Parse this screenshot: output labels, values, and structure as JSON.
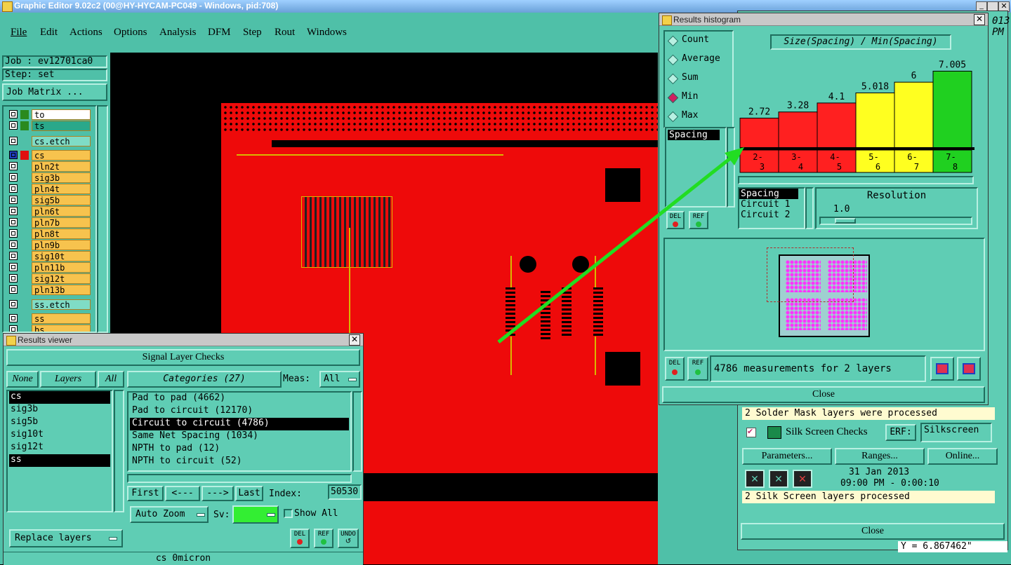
{
  "app": {
    "title": "Graphic Editor 9.02c2 (00@HY-HYCAM-PC049 - Windows, pid:708)",
    "menu": [
      "File",
      "Edit",
      "Actions",
      "Options",
      "Analysis",
      "DFM",
      "Step",
      "Rout",
      "Windows"
    ]
  },
  "job": {
    "job_label": "Job : ev12701ca0",
    "step_label": "Step: set",
    "matrix_button": "Job Matrix ..."
  },
  "layers": [
    {
      "name": "to",
      "color": "#ffffff",
      "sw": "#2a8a1e"
    },
    {
      "name": "ts",
      "color": "#2aa88a",
      "sw": "#2a8a1e"
    },
    {
      "name": "cs.etch",
      "color": "#7fdcc6",
      "sw": ""
    },
    {
      "name": "cs",
      "color": "#f7c34e",
      "sw": "#e01010"
    },
    {
      "name": "pln2t",
      "color": "#f7c34e",
      "sw": ""
    },
    {
      "name": "sig3b",
      "color": "#f7c34e",
      "sw": ""
    },
    {
      "name": "pln4t",
      "color": "#f7c34e",
      "sw": ""
    },
    {
      "name": "sig5b",
      "color": "#f7c34e",
      "sw": ""
    },
    {
      "name": "pln6t",
      "color": "#f7c34e",
      "sw": ""
    },
    {
      "name": "pln7b",
      "color": "#f7c34e",
      "sw": ""
    },
    {
      "name": "pln8t",
      "color": "#f7c34e",
      "sw": ""
    },
    {
      "name": "pln9b",
      "color": "#f7c34e",
      "sw": ""
    },
    {
      "name": "sig10t",
      "color": "#f7c34e",
      "sw": ""
    },
    {
      "name": "pln11b",
      "color": "#f7c34e",
      "sw": ""
    },
    {
      "name": "sig12t",
      "color": "#f7c34e",
      "sw": ""
    },
    {
      "name": "pln13b",
      "color": "#f7c34e",
      "sw": ""
    },
    {
      "name": "ss.etch",
      "color": "#7fdcc6",
      "sw": ""
    },
    {
      "name": "ss",
      "color": "#f7c34e",
      "sw": ""
    },
    {
      "name": "bs",
      "color": "#f7c34e",
      "sw": ""
    }
  ],
  "results_viewer": {
    "title": "Results viewer",
    "header": "Signal Layer Checks",
    "none_btn": "None",
    "layers_btn": "Layers",
    "all_btn": "All",
    "categories_btn": "Categories (27)",
    "meas_label": "Meas:",
    "meas_value": "All",
    "layer_list": [
      "cs",
      "sig3b",
      "sig5b",
      "sig10t",
      "sig12t",
      "ss"
    ],
    "categories": [
      "Pad to pad (4662)",
      "Pad to circuit (12170)",
      "Circuit to circuit (4786)",
      "Same Net Spacing (1034)",
      "NPTH to pad (12)",
      "NPTH to circuit (52)"
    ],
    "first_btn": "First",
    "prev_btn": "<---",
    "next_btn": "--->",
    "last_btn": "Last",
    "index_label": "Index:",
    "index_value": "50530",
    "auto_zoom": "Auto Zoom",
    "sv_label": "Sv:",
    "show_all": "Show All",
    "replace_layers": "Replace layers",
    "del": "DEL",
    "ref": "REF",
    "undo": "UNDO",
    "status": "cs 0micron"
  },
  "histogram": {
    "title": "Results histogram",
    "options": [
      "Count",
      "Average",
      "Sum",
      "Min",
      "Max"
    ],
    "selected_option": "Min",
    "chart_title": "Size(Spacing) / Min(Spacing)",
    "list_items": [
      "Spacing"
    ],
    "list2": [
      "Spacing",
      "Circuit 1",
      "Circuit 2"
    ],
    "resolution_label": "Resolution",
    "resolution_value": "1.0",
    "del": "DEL",
    "ref": "REF",
    "measurements": "4786 measurements for 2 layers",
    "close": "Close"
  },
  "chart_data": {
    "type": "bar",
    "title": "Size(Spacing) / Min(Spacing)",
    "categories": [
      "2-3",
      "3-4",
      "4-5",
      "5-6",
      "6-7",
      "7-8"
    ],
    "values": [
      2.72,
      3.28,
      4.1,
      5.018,
      6,
      7.005
    ],
    "value_labels": [
      "2.72",
      "3.28",
      "4.1",
      "5.018",
      "6",
      "7.005"
    ],
    "colors": [
      "#ff2020",
      "#ff2020",
      "#ff2020",
      "#ffff20",
      "#ffff20",
      "#20d020"
    ],
    "ylim": [
      0,
      7.6
    ]
  },
  "right_panel": {
    "solder_status": "2 Solder Mask layers were processed",
    "silk_label": "Silk Screen Checks",
    "erf_label": "ERF:",
    "erf_value": "Silkscreen",
    "parameters": "Parameters...",
    "ranges": "Ranges...",
    "online": "Online...",
    "date": "31 Jan 2013",
    "time": "09:00 PM - 0:00:10",
    "silk_status": "2 Silk Screen layers processed",
    "close": "Close",
    "coord": "Y = 6.867462\"",
    "partial1": "013",
    "partial2": "PM"
  }
}
